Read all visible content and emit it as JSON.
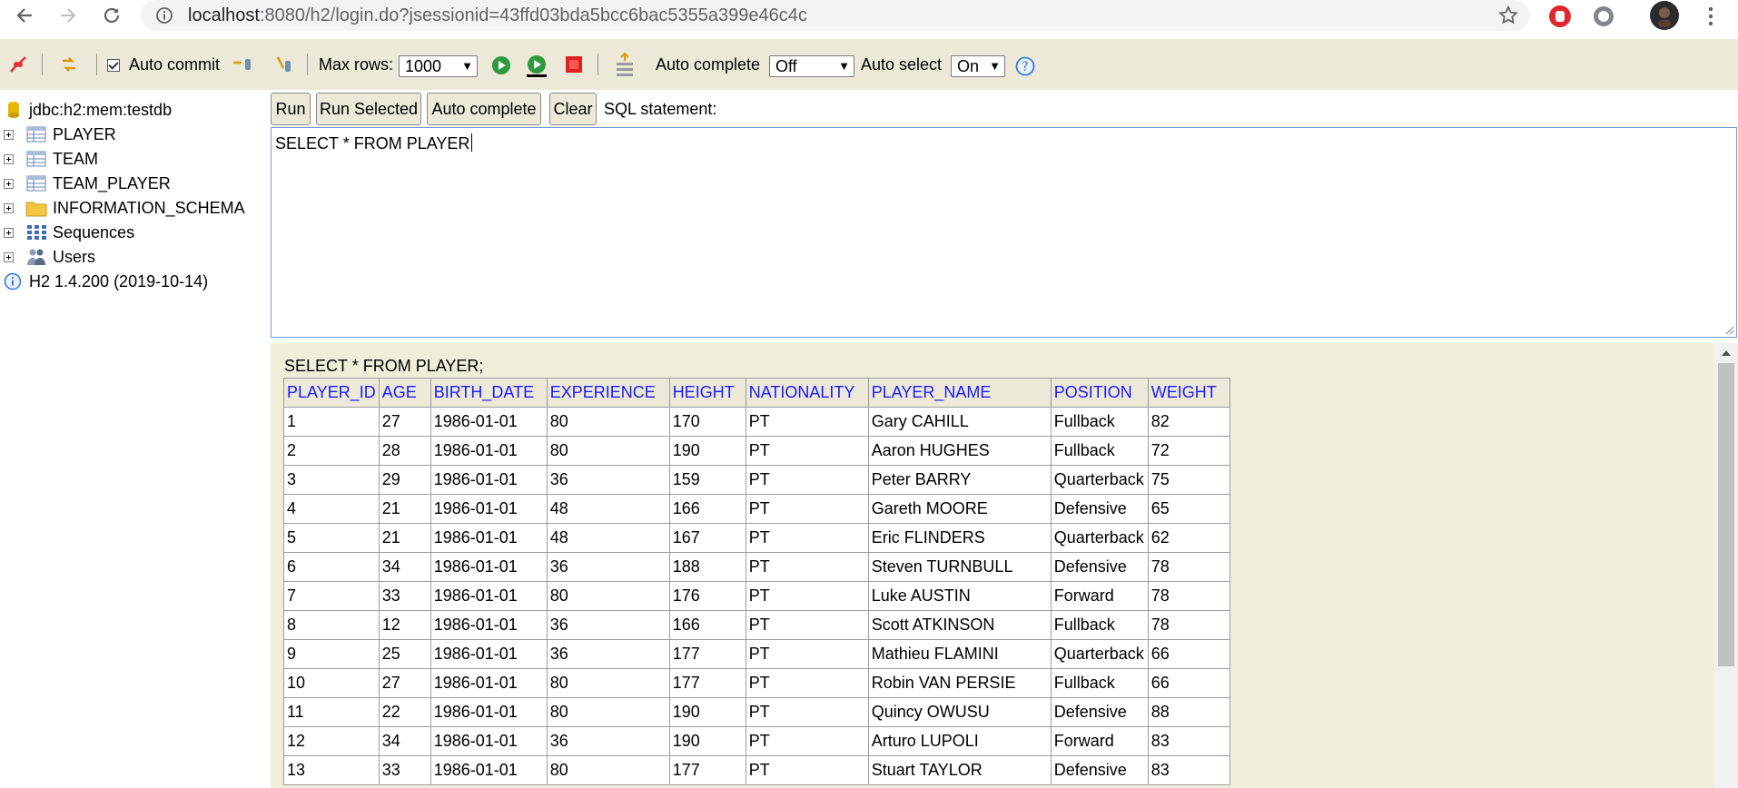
{
  "browser": {
    "url_host": "localhost",
    "url_rest": ":8080/h2/login.do?jsessionid=43ffd03bda5bcc6bac5355a399e46c4c"
  },
  "toolbar": {
    "auto_commit_label": "Auto commit",
    "auto_commit_checked": true,
    "max_rows_label": "Max rows:",
    "max_rows_value": "1000",
    "auto_complete_label": "Auto complete",
    "auto_complete_value": "Off",
    "auto_select_label": "Auto select",
    "auto_select_value": "On"
  },
  "tree": {
    "connection": "jdbc:h2:mem:testdb",
    "items": [
      {
        "label": "PLAYER",
        "icon": "table-icon"
      },
      {
        "label": "TEAM",
        "icon": "table-icon"
      },
      {
        "label": "TEAM_PLAYER",
        "icon": "table-icon"
      },
      {
        "label": "INFORMATION_SCHEMA",
        "icon": "folder-icon"
      },
      {
        "label": "Sequences",
        "icon": "sequences-icon"
      },
      {
        "label": "Users",
        "icon": "users-icon"
      }
    ],
    "version": "H2 1.4.200 (2019-10-14)"
  },
  "query": {
    "run_label": "Run",
    "run_selected_label": "Run Selected",
    "auto_complete_label": "Auto complete",
    "clear_label": "Clear",
    "sql_statement_label": "SQL statement:",
    "sql_text": "SELECT * FROM PLAYER"
  },
  "results": {
    "statement": "SELECT * FROM PLAYER;",
    "columns": [
      "PLAYER_ID",
      "AGE",
      "BIRTH_DATE",
      "EXPERIENCE",
      "HEIGHT",
      "NATIONALITY",
      "PLAYER_NAME",
      "POSITION",
      "WEIGHT"
    ],
    "rows": [
      [
        "1",
        "27",
        "1986-01-01",
        "80",
        "170",
        "PT",
        "Gary CAHILL",
        "Fullback",
        "82"
      ],
      [
        "2",
        "28",
        "1986-01-01",
        "80",
        "190",
        "PT",
        "Aaron HUGHES",
        "Fullback",
        "72"
      ],
      [
        "3",
        "29",
        "1986-01-01",
        "36",
        "159",
        "PT",
        "Peter BARRY",
        "Quarterback",
        "75"
      ],
      [
        "4",
        "21",
        "1986-01-01",
        "48",
        "166",
        "PT",
        "Gareth MOORE",
        "Defensive",
        "65"
      ],
      [
        "5",
        "21",
        "1986-01-01",
        "48",
        "167",
        "PT",
        "Eric FLINDERS",
        "Quarterback",
        "62"
      ],
      [
        "6",
        "34",
        "1986-01-01",
        "36",
        "188",
        "PT",
        "Steven TURNBULL",
        "Defensive",
        "78"
      ],
      [
        "7",
        "33",
        "1986-01-01",
        "80",
        "176",
        "PT",
        "Luke AUSTIN",
        "Forward",
        "78"
      ],
      [
        "8",
        "12",
        "1986-01-01",
        "36",
        "166",
        "PT",
        "Scott ATKINSON",
        "Fullback",
        "78"
      ],
      [
        "9",
        "25",
        "1986-01-01",
        "36",
        "177",
        "PT",
        "Mathieu FLAMINI",
        "Quarterback",
        "66"
      ],
      [
        "10",
        "27",
        "1986-01-01",
        "80",
        "177",
        "PT",
        "Robin VAN PERSIE",
        "Fullback",
        "66"
      ],
      [
        "11",
        "22",
        "1986-01-01",
        "80",
        "190",
        "PT",
        "Quincy OWUSU",
        "Defensive",
        "88"
      ],
      [
        "12",
        "34",
        "1986-01-01",
        "36",
        "190",
        "PT",
        "Arturo LUPOLI",
        "Forward",
        "83"
      ],
      [
        "13",
        "33",
        "1986-01-01",
        "80",
        "177",
        "PT",
        "Stuart TAYLOR",
        "Defensive",
        "83"
      ]
    ]
  }
}
